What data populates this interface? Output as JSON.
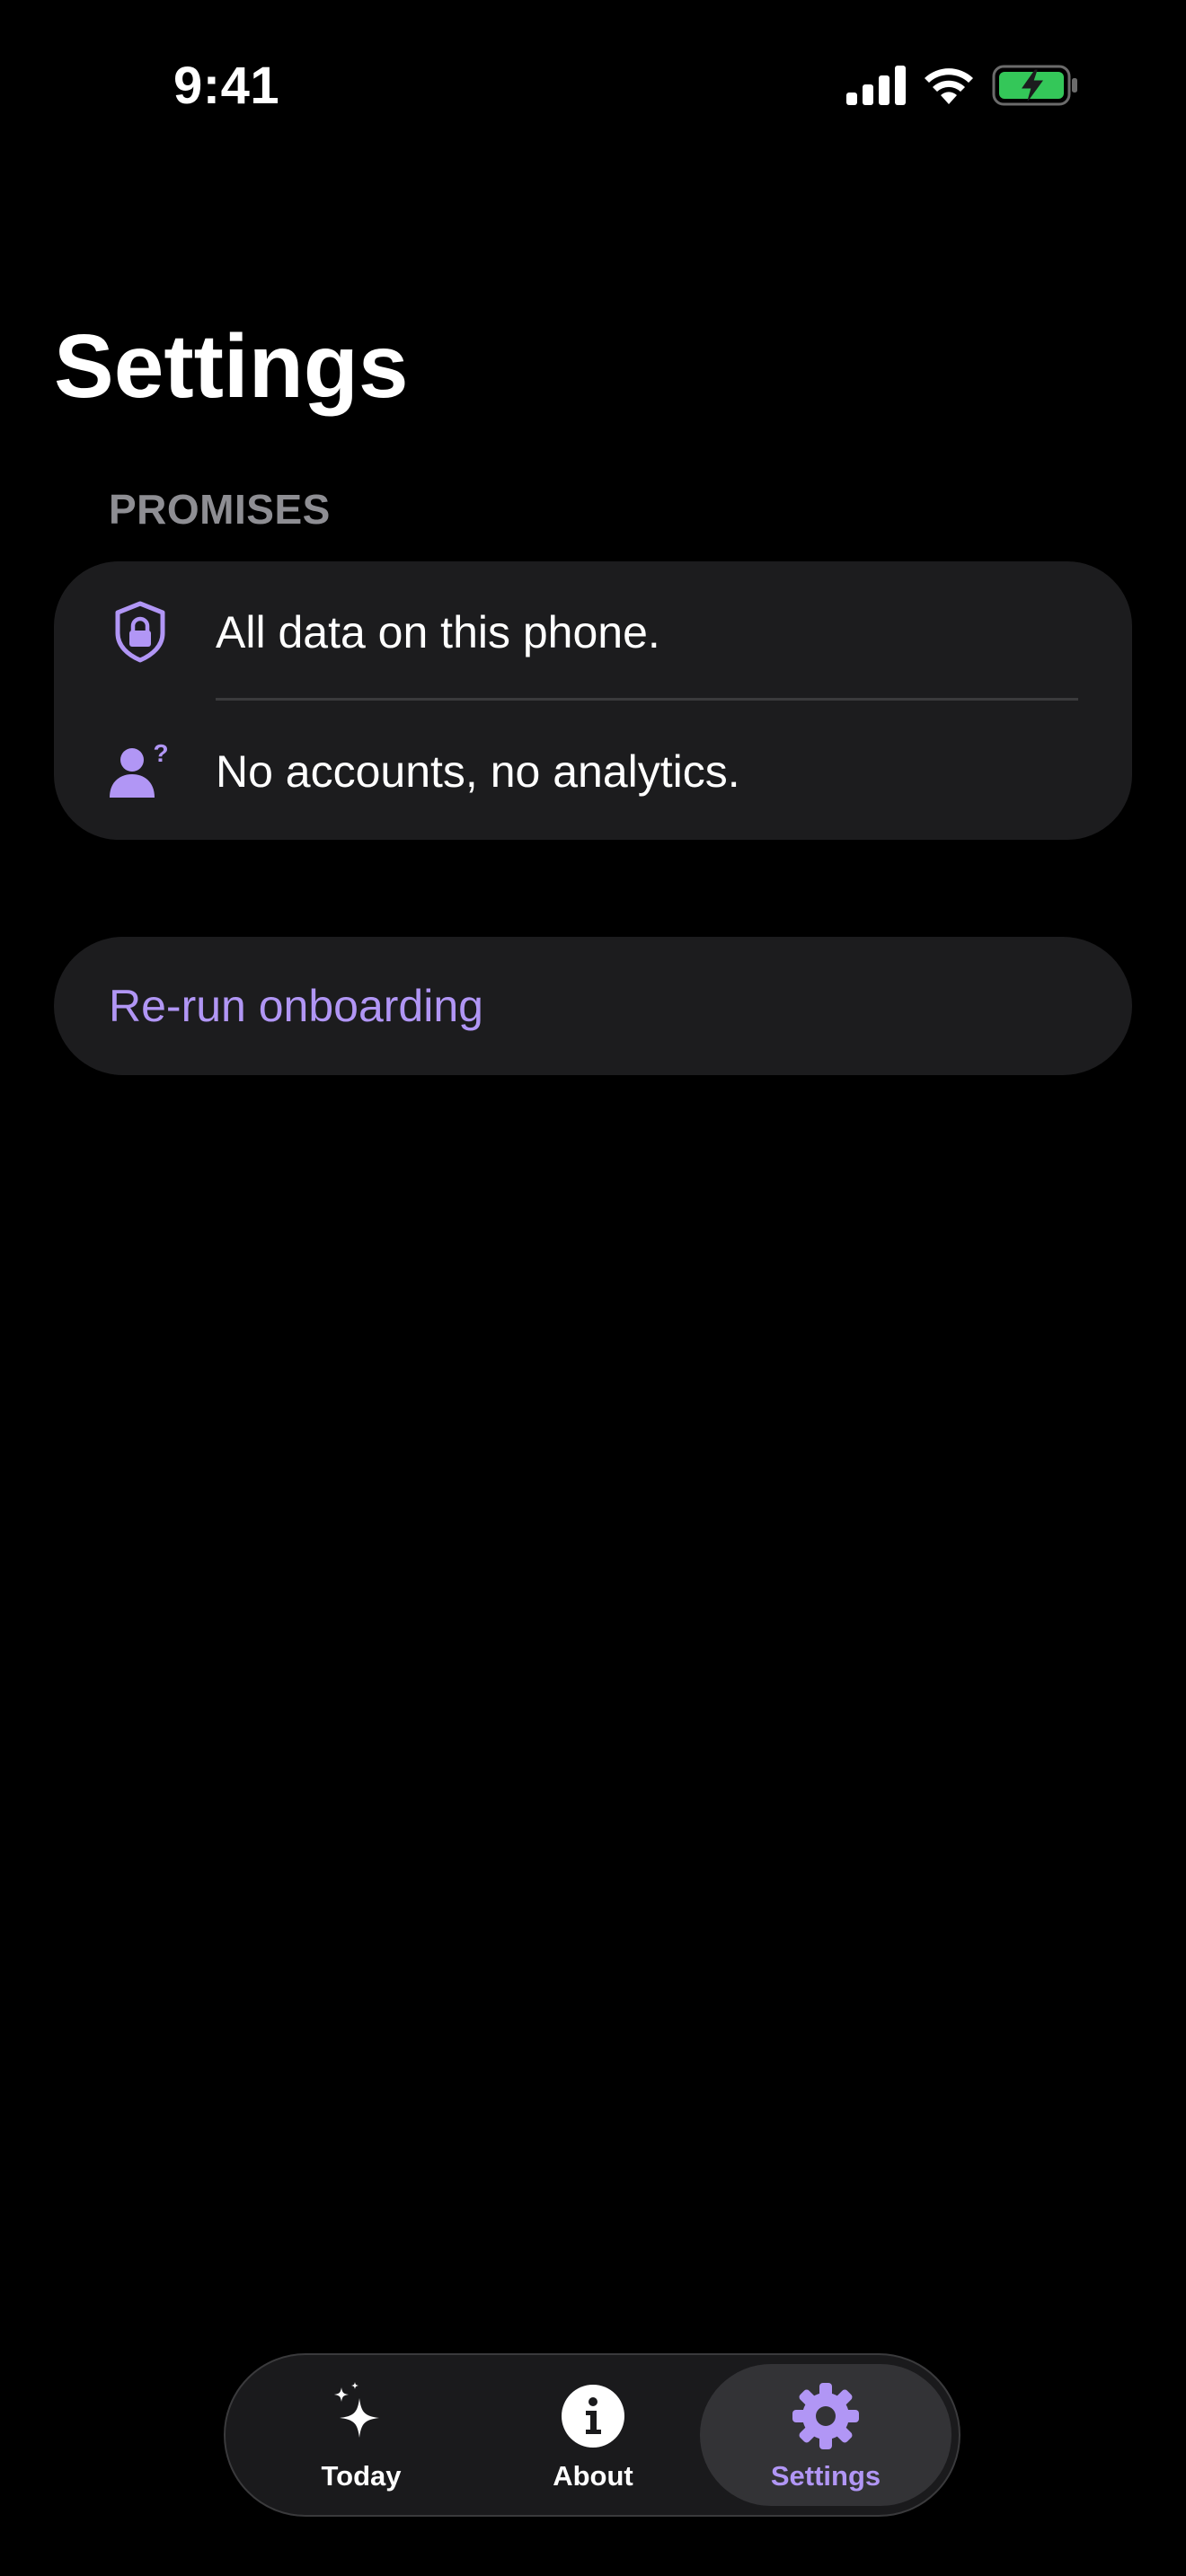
{
  "status_bar": {
    "time": "9:41"
  },
  "page": {
    "title": "Settings"
  },
  "promises": {
    "header": "PROMISES",
    "items": [
      {
        "label": "All data on this phone.",
        "icon": "shield-lock-icon"
      },
      {
        "label": "No accounts, no analytics.",
        "icon": "person-question-icon"
      }
    ]
  },
  "actions": {
    "rerun_onboarding": "Re-run onboarding"
  },
  "tab_bar": {
    "tabs": [
      {
        "label": "Today",
        "icon": "sparkles-icon"
      },
      {
        "label": "About",
        "icon": "info-icon"
      },
      {
        "label": "Settings",
        "icon": "gear-icon",
        "selected": true
      }
    ]
  },
  "colors": {
    "accent": "#b196f5",
    "background": "#000000",
    "card": "#1c1c1e",
    "secondary_text": "#8e8e93",
    "battery": "#34c759"
  }
}
